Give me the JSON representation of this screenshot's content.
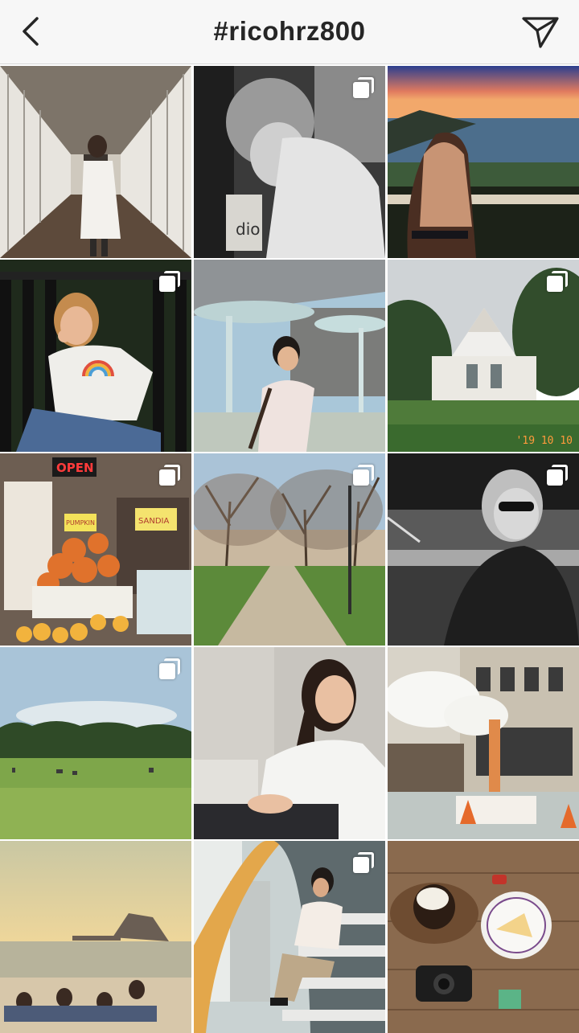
{
  "header": {
    "title": "#ricohrz800",
    "back_icon": "chevron-left-icon",
    "send_icon": "paper-plane-icon"
  },
  "grid": {
    "posts": [
      {
        "id": 1,
        "subject": "hallway-portrait",
        "multi": false
      },
      {
        "id": 2,
        "subject": "elderly-man-bw",
        "multi": true
      },
      {
        "id": 3,
        "subject": "sunset-ocean-girl",
        "multi": false
      },
      {
        "id": 4,
        "subject": "girl-everything-sucks-shirt",
        "multi": true
      },
      {
        "id": 5,
        "subject": "boy-under-umbrella-structures",
        "multi": false
      },
      {
        "id": 6,
        "subject": "white-thai-pavilion",
        "multi": true,
        "stamp": "'19 10 10"
      },
      {
        "id": 7,
        "subject": "pumpkin-market-stand",
        "multi": true
      },
      {
        "id": 8,
        "subject": "tree-lined-path",
        "multi": true
      },
      {
        "id": 9,
        "subject": "woman-sunglasses-bw",
        "multi": true
      },
      {
        "id": 10,
        "subject": "field-and-forest",
        "multi": true
      },
      {
        "id": 11,
        "subject": "woman-white-shirt-laughing",
        "multi": false
      },
      {
        "id": 12,
        "subject": "steam-city-street",
        "multi": false
      },
      {
        "id": 13,
        "subject": "beach-sunset-group",
        "multi": false
      },
      {
        "id": 14,
        "subject": "boy-on-stairs",
        "multi": true
      },
      {
        "id": 15,
        "subject": "coffee-table-camera",
        "multi": false
      }
    ]
  },
  "market_signs": {
    "open": "OPEN",
    "pumpkin": "PUMPKIN",
    "sandia": "SANDIA"
  }
}
